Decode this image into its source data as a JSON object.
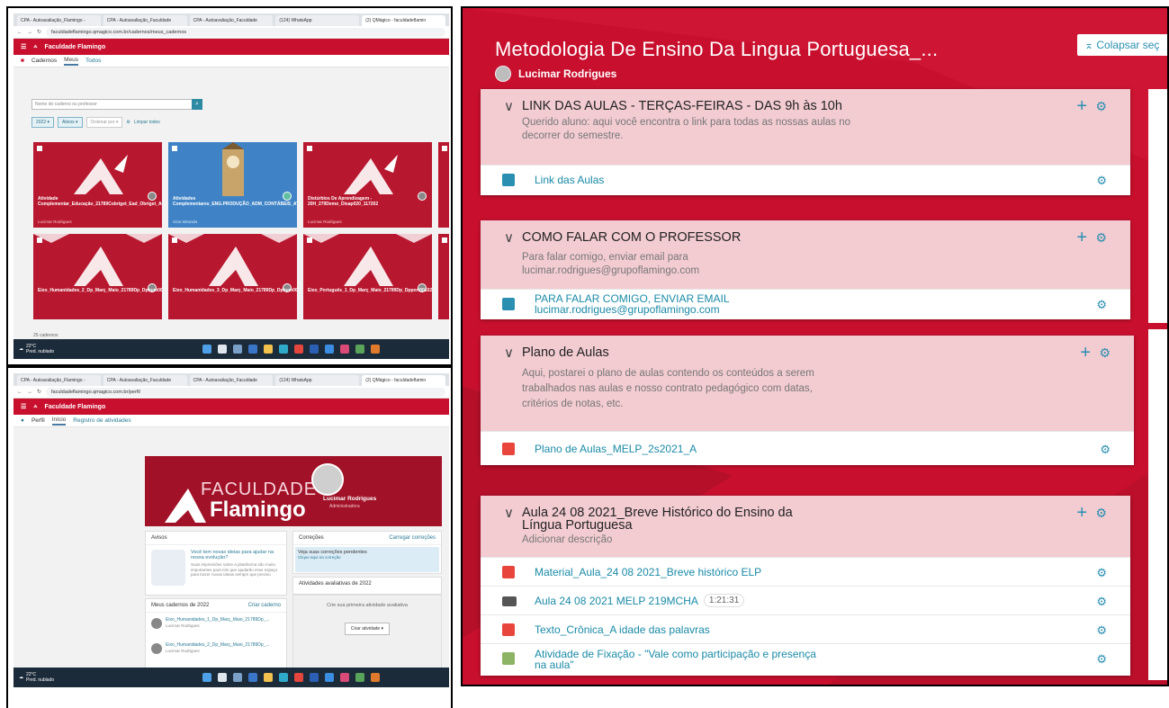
{
  "screen1": {
    "browser_tabs": [
      "CPA - Autoavaliação_Flamingo - ",
      "CPA - Autoavaliação_Faculdade",
      "CPA - Autoavaliação_Faculdade",
      "(124) WhatsApp",
      "(2) QMágico - faculdadeflamin"
    ],
    "url": "faculdadeflamingo.qmagico.com.br/cadernos/meus_cadernos",
    "app_name": "Faculdade Flamingo",
    "section": "Cadernos",
    "tabs": [
      "Meus",
      "Todos"
    ],
    "search_placeholder": "Nome do caderno ou professor",
    "filters": [
      "2022 ▾",
      "Ativos ▾",
      "Ordenar por ▾",
      "Limpar todos"
    ],
    "cards": [
      {
        "title": "Atividade Complementar_Educação_21789Cobriget_Ead_Obriget_Atcom200_121854",
        "owner": "Lucimar Rodrigues"
      },
      {
        "title": "Atividades Complementares_ENG.PRODUÇÃO_ADM_CONTÁBEIS_ATCOM120_102730",
        "owner": "Gina Miranda"
      },
      {
        "title": "Distúrbios De Aprendizagem - 20H_279Demo_Disap020_117202",
        "owner": "Lucimar Rodrigues"
      },
      {
        "title": "Eixo_Humanidades_2_Dp_Març_Maio_21789Dp_Dphum002020_121873",
        "owner": ""
      },
      {
        "title": "Eixo_Humanidades_3_Dp_Març_Maio_21789Dp_Dphum003020_121875",
        "owner": ""
      },
      {
        "title": "Eixo_Português_1_Dp_Març_Maio_21789Dp_Dpport001020_121879",
        "owner": ""
      }
    ],
    "count": "25 cadernos",
    "weather_temp": "22°C",
    "weather_desc": "Pred. nublado"
  },
  "screen2": {
    "url": "faculdadeflamingo.qmagico.com.br/perfil",
    "app_name": "Faculdade Flamingo",
    "section": "Perfil",
    "tabs": [
      "Início",
      "Registro de atividades"
    ],
    "banner_line1": "FACULDADE",
    "banner_line2": "Flamingo",
    "profile_name": "Lucimar Rodrigues",
    "profile_role": "Administradora",
    "avisos_title": "Avisos",
    "avisos_headline": "Você tem novas ideias para ajudar na nossa evolução?",
    "avisos_text": "Suas impressões sobre a plataforma são muito importantes para nós que ajudarão esse espaço para trazer novas ideias sempre que preciso",
    "correcoes_title": "Correções",
    "correcoes_link": "Carregar correções",
    "correcoes_pending": "Veja suas correções pendentes",
    "correcoes_sub": "Clique aqui na correção",
    "atividades_title": "Atividades avaliativas de 2022",
    "atividades_empty": "Crie sua primeira atividade avaliativa",
    "atividades_button": "Criar atividade ▾",
    "cadernos_title": "Meus cadernos de 2022",
    "cadernos_link": "Criar caderno",
    "cadernos": [
      {
        "name": "Eixo_Humanidades_1_Dp_Març_Maio_21789Dp_...",
        "owner": "Lucimar Rodrigues"
      },
      {
        "name": "Eixo_Humanidades_2_Dp_Març_Maio_21789Dp_...",
        "owner": "Lucimar Rodrigues"
      }
    ],
    "weather_temp": "22°C",
    "weather_desc": "Pred. nublado"
  },
  "main": {
    "title": "Metodologia De Ensino Da Lingua Portuguesa_...",
    "collapse_button": "⌅ Colapsar seç",
    "author": "Lucimar Rodrigues",
    "sections": [
      {
        "title": "LINK DAS AULAS - TERÇAS-FEIRAS - DAS 9h às 10h",
        "description": "Querido aluno: aqui você encontra o link para todas as nossas aulas no decorrer do semestre.",
        "items": [
          {
            "type": "doc",
            "label": "Link das Aulas"
          }
        ]
      },
      {
        "title": "COMO FALAR COM O PROFESSOR",
        "description": "Para falar comigo, enviar email para lucimar.rodrigues@grupoflamingo.com",
        "items": [
          {
            "type": "doc",
            "label": "PARA FALAR COMIGO, ENVIAR EMAIL lucimar.rodrigues@grupoflamingo.com"
          }
        ]
      },
      {
        "title": "Plano de Aulas",
        "description": "Aqui, postarei o plano de aulas contendo os conteúdos a serem trabalhados nas aulas e nosso contrato pedagógico com datas, critérios de notas, etc.",
        "items": [
          {
            "type": "pdf",
            "label": "Plano de Aulas_MELP_2s2021_A"
          }
        ]
      },
      {
        "title": "Aula 24 08 2021_Breve Histórico do Ensino da Língua Portuguesa",
        "description": "Adicionar descrição",
        "items": [
          {
            "type": "pdf",
            "label": "Material_Aula_24 08 2021_Breve histórico ELP"
          },
          {
            "type": "video",
            "label": "Aula 24 08 2021 MELP 219MCHA",
            "duration": "1:21:31"
          },
          {
            "type": "pdf",
            "label": "Texto_Crônica_A idade das palavras"
          },
          {
            "type": "task",
            "label": "Atividade de Fixação - \"Vale como participação e presença na aula\""
          }
        ]
      }
    ]
  }
}
